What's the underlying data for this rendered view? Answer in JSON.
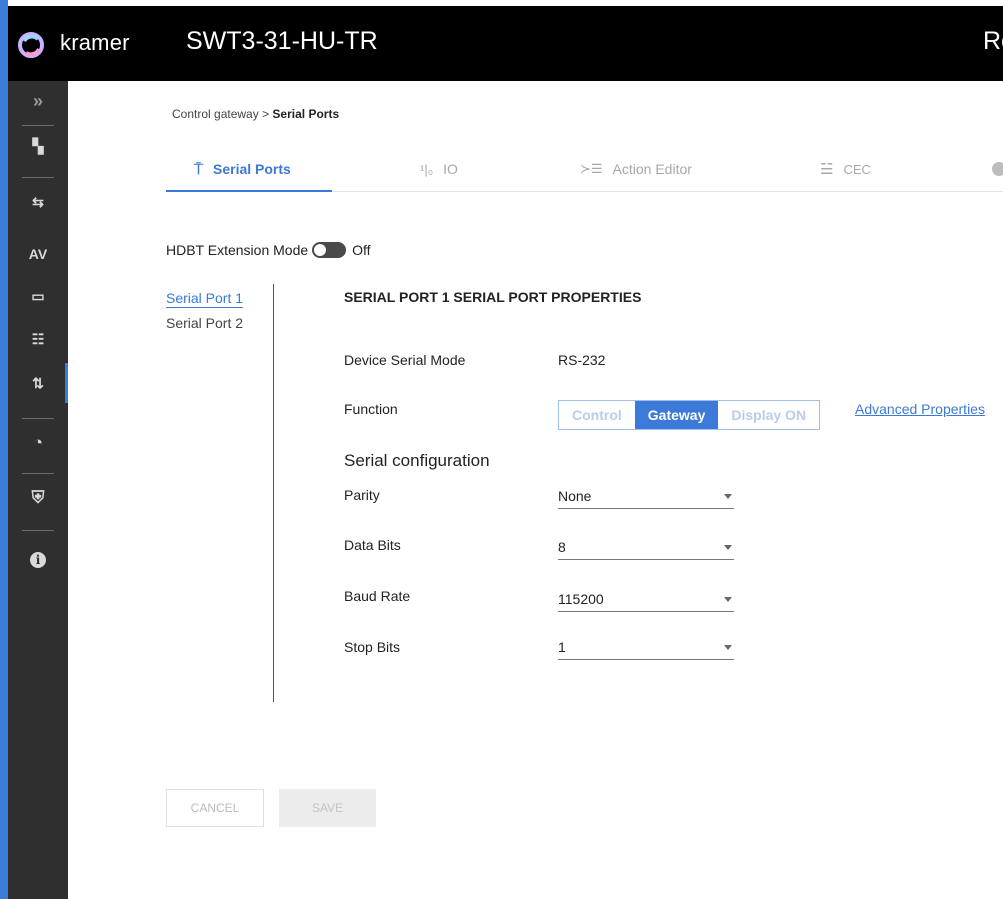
{
  "header": {
    "brand": "kramer",
    "device_name": "SWT3-31-HU-TR",
    "right_text": "Re"
  },
  "sidebar": {
    "items": [
      {
        "icon": "expand-chevrons-icon",
        "glyph": "»"
      },
      {
        "icon": "topology-icon",
        "glyph": "▚"
      },
      {
        "icon": "auto-switch-icon",
        "glyph": "⇆"
      },
      {
        "icon": "av-icon",
        "glyph": "AV"
      },
      {
        "icon": "edid-icon",
        "glyph": "▭"
      },
      {
        "icon": "settings-list-icon",
        "glyph": "☷"
      },
      {
        "icon": "control-gateway-icon",
        "glyph": "⇅"
      },
      {
        "icon": "diagnostics-gauge-icon",
        "glyph": "◔"
      },
      {
        "icon": "security-shield-icon",
        "glyph": "⛨"
      },
      {
        "icon": "info-icon",
        "glyph": "i"
      }
    ]
  },
  "breadcrumb": {
    "parent": "Control gateway",
    "separator": ">",
    "current": "Serial Ports"
  },
  "tabs": [
    {
      "label": "Serial Ports",
      "icon": "serial-plug-icon",
      "glyph": "⍑"
    },
    {
      "label": "IO",
      "icon": "io-icon",
      "glyph": "¹|₀"
    },
    {
      "label": "Action Editor",
      "icon": "action-editor-icon",
      "glyph": "≻☰"
    },
    {
      "label": "CEC",
      "icon": "cec-sliders-icon",
      "glyph": "☱"
    }
  ],
  "hdbt": {
    "label": "HDBT Extension Mode",
    "state": "Off"
  },
  "ports": {
    "items": [
      "Serial Port 1",
      "Serial Port 2"
    ],
    "active_index": 0
  },
  "properties": {
    "title": "SERIAL PORT 1 SERIAL PORT PROPERTIES",
    "device_serial_mode_label": "Device Serial Mode",
    "device_serial_mode_value": "RS-232",
    "function_label": "Function",
    "function_options": [
      "Control",
      "Gateway",
      "Display ON"
    ],
    "function_selected": "Gateway",
    "advanced_link": "Advanced Properties",
    "serial_config_title": "Serial configuration",
    "fields": [
      {
        "label": "Parity",
        "value": "None"
      },
      {
        "label": "Data Bits",
        "value": "8"
      },
      {
        "label": "Baud Rate",
        "value": "115200"
      },
      {
        "label": "Stop Bits",
        "value": "1"
      }
    ]
  },
  "actions": {
    "cancel": "CANCEL",
    "save": "SAVE"
  },
  "colors": {
    "accent": "#3b7ad8",
    "sidebar": "#2f2f2f",
    "topbar": "#000000"
  }
}
